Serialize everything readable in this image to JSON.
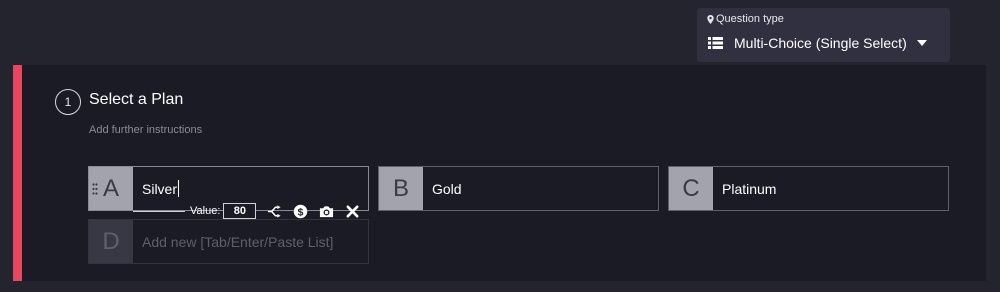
{
  "question_type": {
    "label": "Question type",
    "selected": "Multi-Choice (Single Select)"
  },
  "question": {
    "number": "1",
    "title": "Select a Plan",
    "instructions_placeholder": "Add further instructions"
  },
  "options": [
    {
      "letter": "A",
      "text": "Silver"
    },
    {
      "letter": "B",
      "text": "Gold"
    },
    {
      "letter": "C",
      "text": "Platinum"
    }
  ],
  "option_toolbar": {
    "value_label": "Value:",
    "value": "80"
  },
  "new_option": {
    "letter": "D",
    "placeholder": "Add new [Tab/Enter/Paste List]"
  },
  "icons": {
    "location": "map-pin-icon",
    "list": "list-icon",
    "caret": "chevron-down-icon",
    "branch": "branch-icon",
    "dollar": "dollar-icon",
    "camera": "camera-icon",
    "close": "close-icon",
    "drag": "drag-handle-icon"
  },
  "colors": {
    "accent": "#e8455f",
    "background": "#24242f",
    "card": "#1b1b26"
  }
}
